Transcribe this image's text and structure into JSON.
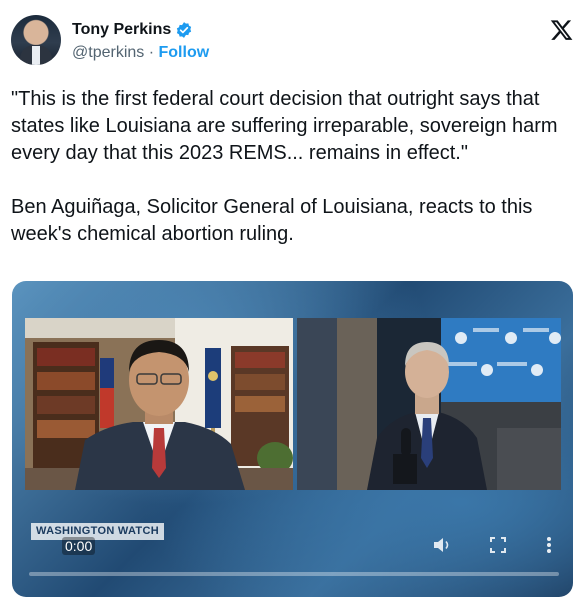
{
  "author": {
    "name": "Tony Perkins",
    "handle": "@tperkins",
    "separator": "·",
    "follow_label": "Follow",
    "verified_icon": "verified-badge-icon",
    "avatar_icon": "profile-photo"
  },
  "platform_icon": "x-logo-icon",
  "tweet": {
    "quote": "\"This is the first federal court decision that outright says that states like Louisiana are suffering irreparable, sovereign harm every day that this 2023 REMS... remains in effect.\"",
    "body": "Ben Aguiñaga, Solicitor General of Louisiana, reacts to this week's chemical abortion ruling."
  },
  "video": {
    "watermark": "WASHINGTON WATCH",
    "time": "0:00",
    "progress": 0,
    "controls": [
      "volume-icon",
      "fullscreen-icon",
      "more-options-icon"
    ]
  },
  "colors": {
    "accent": "#1d9bf0",
    "text": "#0f1419",
    "secondary_text": "#536471"
  }
}
